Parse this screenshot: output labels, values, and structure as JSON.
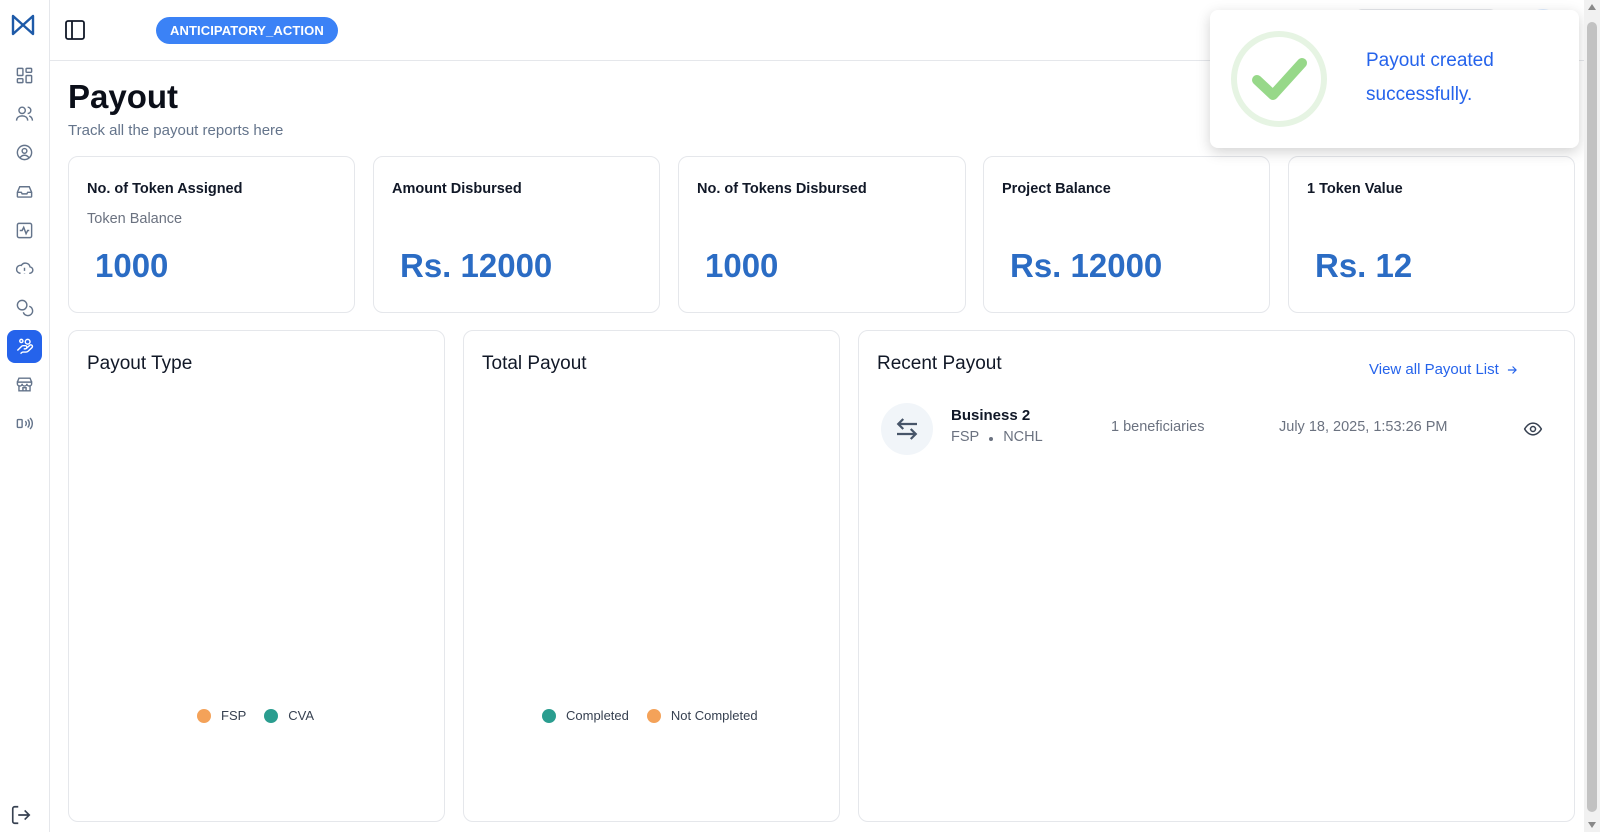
{
  "header": {
    "project_badge": "ANTICIPATORY_ACTION"
  },
  "page": {
    "title": "Payout",
    "subtitle": "Track all the payout reports here"
  },
  "sidebar": {
    "items": [
      {
        "icon": "dashboard-icon"
      },
      {
        "icon": "users-icon"
      },
      {
        "icon": "user-circle-icon"
      },
      {
        "icon": "inbox-icon"
      },
      {
        "icon": "activity-icon"
      },
      {
        "icon": "cloud-alert-icon"
      },
      {
        "icon": "coins-icon"
      },
      {
        "icon": "hand-coins-icon",
        "active": true
      },
      {
        "icon": "store-icon"
      },
      {
        "icon": "broadcast-icon"
      }
    ],
    "logout_icon": "logout-icon"
  },
  "stats": [
    {
      "label": "No. of Token Assigned",
      "sub": "Token Balance",
      "value": "1000"
    },
    {
      "label": "Amount Disbursed",
      "sub": "",
      "value": "Rs. 12000"
    },
    {
      "label": "No. of Tokens Disbursed",
      "sub": "",
      "value": "1000"
    },
    {
      "label": "Project Balance",
      "sub": "",
      "value": "Rs. 12000"
    },
    {
      "label": "1 Token Value",
      "sub": "",
      "value": "Rs. 12"
    }
  ],
  "payout_type": {
    "title": "Payout Type",
    "legend": [
      {
        "label": "FSP",
        "color": "#f4a259"
      },
      {
        "label": "CVA",
        "color": "#2a9d8f"
      }
    ]
  },
  "total_payout": {
    "title": "Total Payout",
    "legend": [
      {
        "label": "Completed",
        "color": "#2a9d8f"
      },
      {
        "label": "Not Completed",
        "color": "#f4a259"
      }
    ]
  },
  "recent_payout": {
    "title": "Recent Payout",
    "view_all": "View all Payout List",
    "rows": [
      {
        "name": "Business 2",
        "type": "FSP",
        "provider": "NCHL",
        "beneficiaries": "1 beneficiaries",
        "date": "July 18, 2025, 1:53:26 PM"
      }
    ]
  },
  "toast": {
    "message": "Payout created successfully.",
    "color": "#2563eb"
  },
  "colors": {
    "accent": "#2563eb",
    "badge": "#3b82f6",
    "value": "#2b6cc4"
  }
}
